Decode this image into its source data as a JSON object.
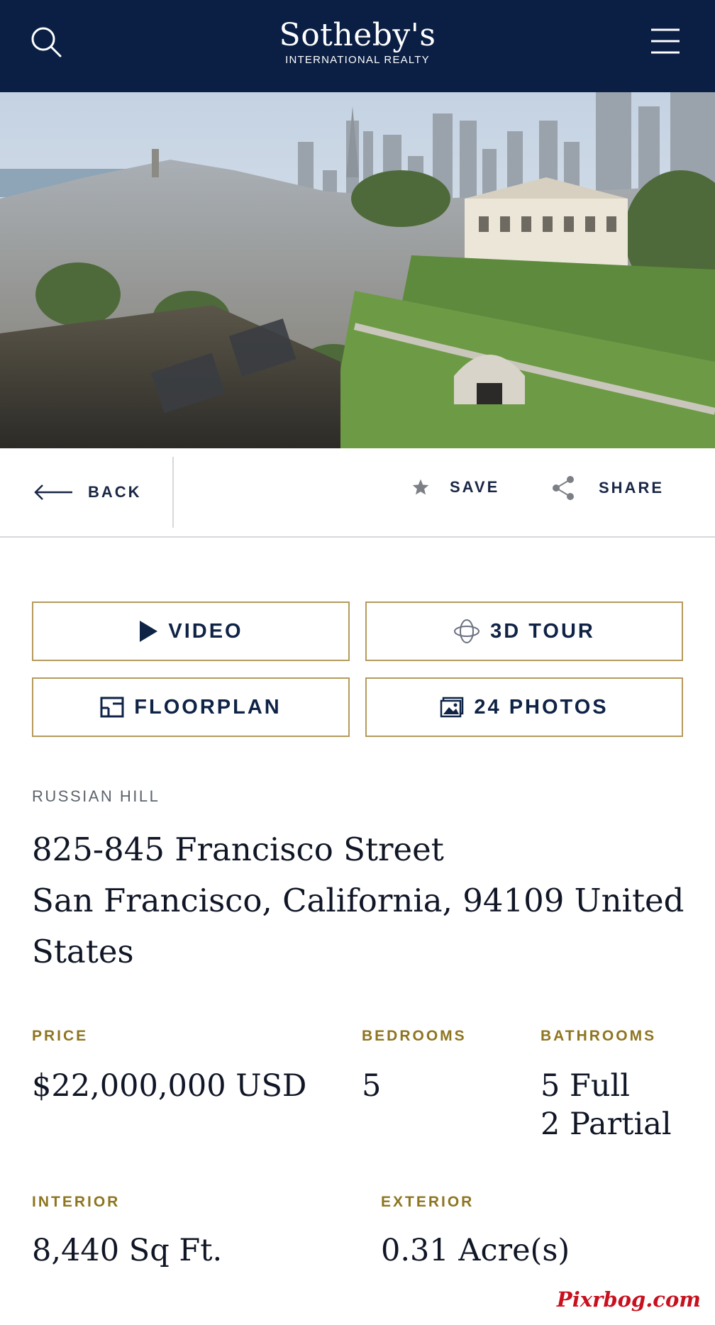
{
  "header": {
    "brand": "Sotheby's",
    "brand_sub": "INTERNATIONAL REALTY",
    "icons": {
      "search": "search-icon",
      "menu": "menu-icon"
    }
  },
  "hero": {
    "alt": "Aerial view of Russian Hill with San Francisco skyline"
  },
  "actions": {
    "back_label": "BACK",
    "save_label": "SAVE",
    "share_label": "SHARE"
  },
  "media_buttons": {
    "video": "VIDEO",
    "tour": "3D TOUR",
    "floorplan": "FLOORPLAN",
    "photos": "24 PHOTOS"
  },
  "listing": {
    "neighborhood": "RUSSIAN HILL",
    "address_line1": "825-845 Francisco Street",
    "address_line2": "San Francisco, California, 94109 United",
    "address_line3": "States",
    "price_label": "PRICE",
    "price": "$22,000,000 USD",
    "bedrooms_label": "BEDROOMS",
    "bedrooms": "5",
    "bathrooms_label": "BATHROOMS",
    "bathrooms_full": "5 Full",
    "bathrooms_partial": "2 Partial",
    "interior_label": "INTERIOR",
    "interior": "8,440 Sq Ft.",
    "exterior_label": "EXTERIOR",
    "exterior": "0.31 Acre(s)"
  },
  "watermark": "Pixrbog.com",
  "colors": {
    "header_bg": "#0b1f44",
    "accent_gold": "#b59a5d",
    "label_gold": "#8e7520",
    "text_navy": "#0f2346"
  }
}
